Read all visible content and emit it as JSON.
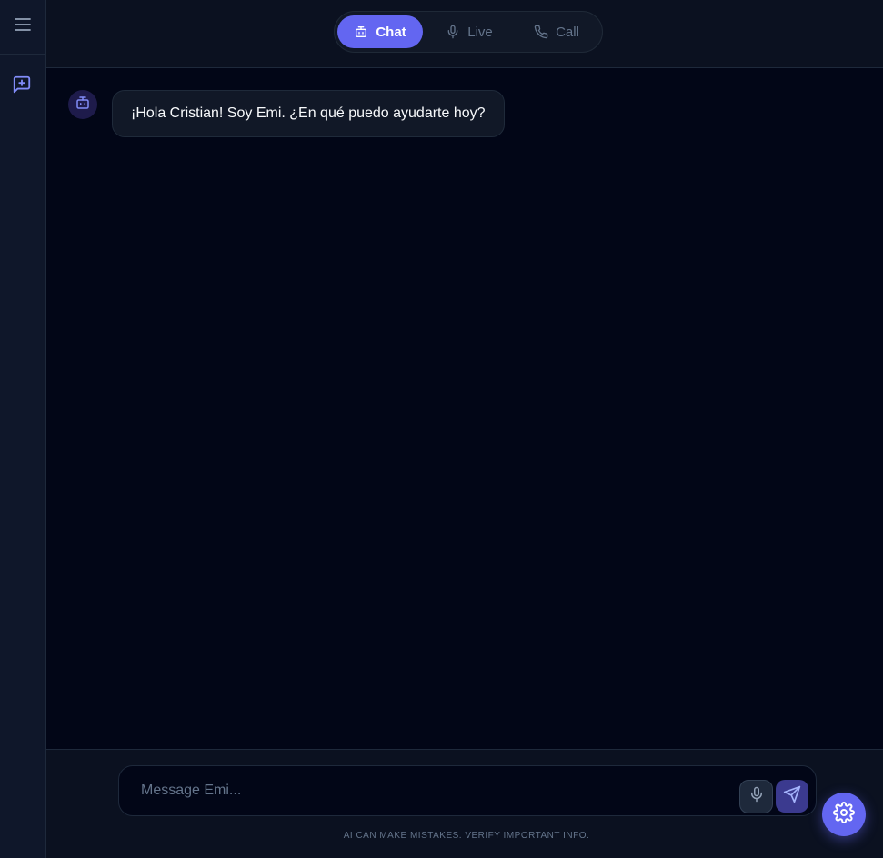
{
  "sidebar": {
    "menu_icon": "menu-icon",
    "new_chat_icon": "message-plus-icon"
  },
  "mode_switch": {
    "active": "chat",
    "tabs": [
      {
        "id": "chat",
        "label": "Chat",
        "icon": "robot-icon"
      },
      {
        "id": "live",
        "label": "Live",
        "icon": "microphone-icon"
      },
      {
        "id": "call",
        "label": "Call",
        "icon": "phone-icon"
      }
    ]
  },
  "messages": [
    {
      "sender": "assistant",
      "avatar_icon": "robot-icon",
      "text": "¡Hola Cristian! Soy Emi. ¿En qué puedo ayudarte hoy?"
    }
  ],
  "composer": {
    "placeholder": "Message Emi...",
    "value": "",
    "mic_icon": "microphone-icon",
    "send_icon": "send-icon"
  },
  "disclaimer": "AI CAN MAKE MISTAKES. VERIFY IMPORTANT INFO.",
  "settings_icon": "gear-icon",
  "colors": {
    "accent": "#6366f1",
    "background": "#020617",
    "panel": "#0f172a"
  }
}
